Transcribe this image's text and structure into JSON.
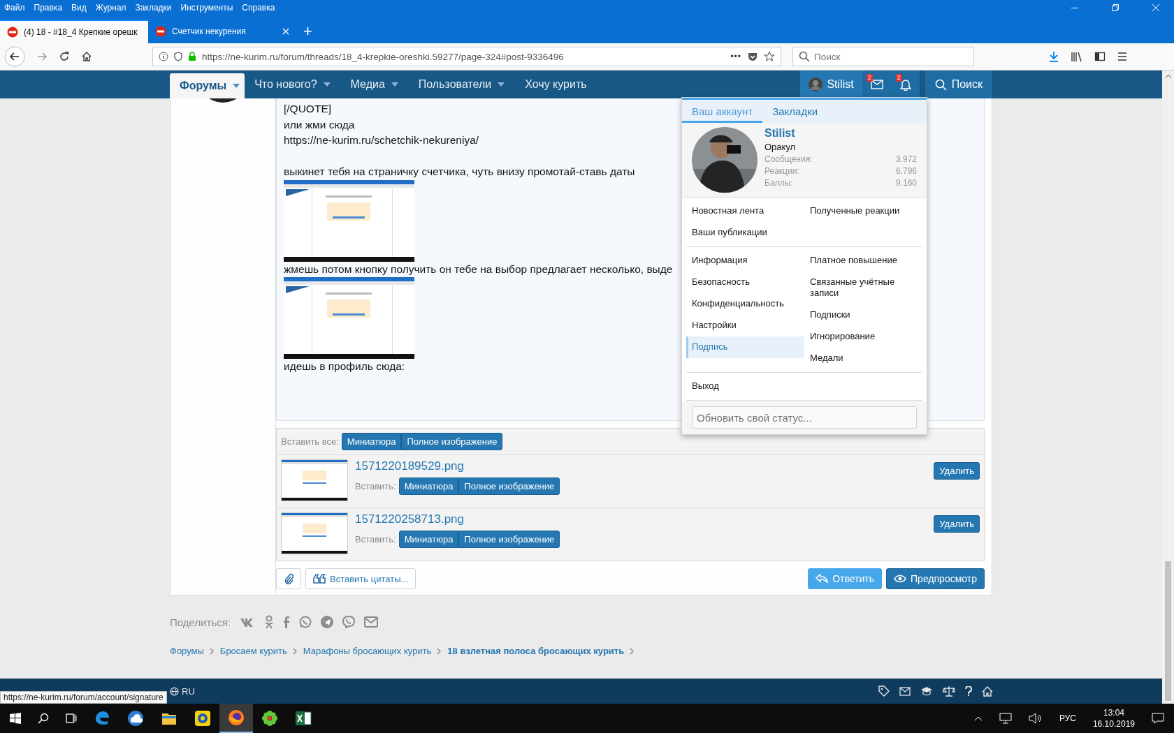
{
  "browser": {
    "menu": [
      "Файл",
      "Правка",
      "Вид",
      "Журнал",
      "Закладки",
      "Инструменты",
      "Справка"
    ],
    "tabs": [
      {
        "label": "(4) 18 - #18_4 Крепкие орешк",
        "selected": true
      },
      {
        "label": "Счетчик некурения",
        "selected": false
      }
    ],
    "new_tab": "+",
    "url": "https://ne-kurim.ru/forum/threads/18_4-krepkie-oreshki.59277/page-324#post-9336496",
    "url_menu": "•••",
    "search_placeholder": "Поиск"
  },
  "site_nav": {
    "items": [
      {
        "label": "Форумы",
        "selected": true,
        "has_menu": true
      },
      {
        "label": "Что нового?",
        "selected": false,
        "has_menu": true
      },
      {
        "label": "Медиа",
        "selected": false,
        "has_menu": true
      },
      {
        "label": "Пользователи",
        "selected": false,
        "has_menu": true
      },
      {
        "label": "Хочу курить",
        "selected": false,
        "has_menu": false
      }
    ],
    "user": "Stilist",
    "inbox_count": "2",
    "alerts_count": "2",
    "search": "Поиск"
  },
  "post": {
    "blocks": [
      {
        "kind": "text",
        "text": "[/QUOTE]"
      },
      {
        "kind": "text",
        "text": "или жми сюда"
      },
      {
        "kind": "text",
        "text": "https://ne-kurim.ru/schetchik-nekureniya/"
      },
      {
        "kind": "blank"
      },
      {
        "kind": "text",
        "text": "выкинет тебя на страничку счетчика, чуть внизу промотай-ставь даты"
      },
      {
        "kind": "picture"
      },
      {
        "kind": "text",
        "text": "жмешь потом кнопку получить он тебе на выбор предлагает несколько, выде"
      },
      {
        "kind": "picture"
      },
      {
        "kind": "text",
        "text": "идешь в профиль сюда:"
      }
    ]
  },
  "attachments": {
    "insert_all_label": "Вставить все:",
    "insert_all_buttons": [
      "Миниатюра",
      "Полное изображение"
    ],
    "files": [
      {
        "name": "1571220189529.png",
        "insert_label": "Вставить:",
        "buttons": [
          "Миниатюра",
          "Полное изображение"
        ],
        "delete": "Удалить"
      },
      {
        "name": "1571220258713.png",
        "insert_label": "Вставить:",
        "buttons": [
          "Миниатюра",
          "Полное изображение"
        ],
        "delete": "Удалить"
      }
    ]
  },
  "editor_actions": {
    "quote": "Вставить цитаты...",
    "reply": "Ответить",
    "preview": "Предпросмотр"
  },
  "share": {
    "label": "Поделиться:"
  },
  "breadcrumbs": [
    {
      "label": "Форумы",
      "current": false
    },
    {
      "label": "Бросаем курить",
      "current": false
    },
    {
      "label": "Марафоны бросающих курить",
      "current": false
    },
    {
      "label": "18 взлетная полоса бросающих курить",
      "current": true
    }
  ],
  "footer": {
    "language": "RU"
  },
  "status_url": "https://ne-kurim.ru/forum/account/signature",
  "account_menu": {
    "tabs": [
      {
        "label": "Ваш аккаунт",
        "selected": true
      },
      {
        "label": "Закладки",
        "selected": false
      }
    ],
    "name": "Stilist",
    "title": "Оракул",
    "stats": [
      {
        "label": "Сообщения:",
        "value": "3.972"
      },
      {
        "label": "Реакции:",
        "value": "6.796"
      },
      {
        "label": "Баллы:",
        "value": "9.160"
      }
    ],
    "sections": [
      {
        "left": [
          {
            "label": "Новостная лента",
            "selected": false
          },
          {
            "label": "Ваши публикации",
            "selected": false
          }
        ],
        "right": [
          {
            "label": "Полученные реакции",
            "selected": false
          }
        ]
      },
      {
        "left": [
          {
            "label": "Информация",
            "selected": false
          },
          {
            "label": "Безопасность",
            "selected": false
          },
          {
            "label": "Конфиденциальность",
            "selected": false
          },
          {
            "label": "Настройки",
            "selected": false
          },
          {
            "label": "Подпись",
            "selected": true
          }
        ],
        "right": [
          {
            "label": "Платное повышение",
            "selected": false
          },
          {
            "label": "Связанные учётные записи",
            "selected": false
          },
          {
            "label": "Подписки",
            "selected": false
          },
          {
            "label": "Игнорирование",
            "selected": false
          },
          {
            "label": "Медали",
            "selected": false
          }
        ]
      },
      {
        "left": [
          {
            "label": "Выход",
            "selected": false
          }
        ]
      }
    ],
    "status_placeholder": "Обновить свой статус..."
  },
  "taskbar": {
    "apps": [
      {
        "kind": "edge",
        "selected": false
      },
      {
        "kind": "cloud",
        "selected": false
      },
      {
        "kind": "folder",
        "selected": false
      },
      {
        "kind": "player",
        "selected": false
      },
      {
        "kind": "firefox",
        "selected": true
      },
      {
        "kind": "flower",
        "selected": false
      },
      {
        "kind": "excel",
        "selected": false
      }
    ],
    "language": "РУС",
    "time": "13:04",
    "date": "16.10.2019"
  }
}
